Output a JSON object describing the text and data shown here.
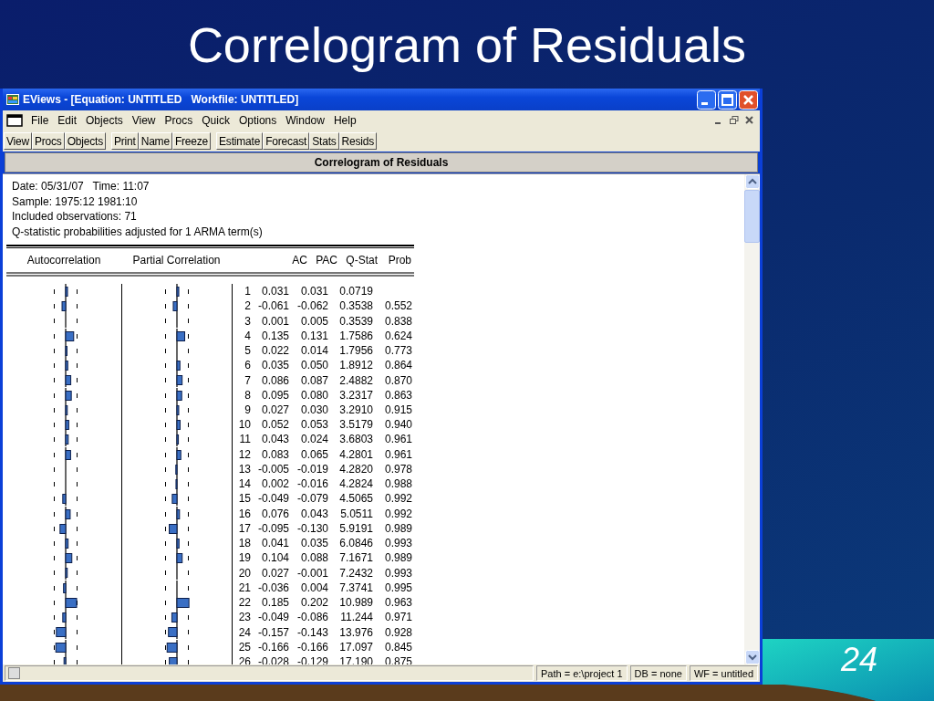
{
  "slide": {
    "title": "Correlogram of Residuals",
    "page_number": "24"
  },
  "window": {
    "title": "EViews - [Equation: UNTITLED   Workfile: UNTITLED]"
  },
  "menu": [
    "File",
    "Edit",
    "Objects",
    "View",
    "Procs",
    "Quick",
    "Options",
    "Window",
    "Help"
  ],
  "toolbar": [
    [
      "View",
      "Procs",
      "Objects"
    ],
    [
      "Print",
      "Name",
      "Freeze"
    ],
    [
      "Estimate",
      "Forecast",
      "Stats",
      "Resids"
    ]
  ],
  "view_title": "Correlogram of Residuals",
  "info_lines": [
    "Date: 05/31/07   Time: 11:07",
    "Sample: 1975:12 1981:10",
    "Included observations: 71",
    "Q-statistic probabilities adjusted for 1 ARMA term(s)"
  ],
  "table": {
    "columns": [
      "Autocorrelation",
      "Partial Correlation",
      "AC",
      "PAC",
      "Q-Stat",
      "Prob"
    ],
    "rows": [
      {
        "lag": "1",
        "ac": "0.031",
        "pac": "0.031",
        "q_stat": "0.0719"
      },
      {
        "lag": "2",
        "ac": "-0.061",
        "pac": "-0.062",
        "q_stat": "0.3538",
        "prob": "0.552"
      },
      {
        "lag": "3",
        "ac": "0.001",
        "pac": "0.005",
        "q_stat": "0.3539",
        "prob": "0.838"
      },
      {
        "lag": "4",
        "ac": "0.135",
        "pac": "0.131",
        "q_stat": "1.7586",
        "prob": "0.624"
      },
      {
        "lag": "5",
        "ac": "0.022",
        "pac": "0.014",
        "q_stat": "1.7956",
        "prob": "0.773"
      },
      {
        "lag": "6",
        "ac": "0.035",
        "pac": "0.050",
        "q_stat": "1.8912",
        "prob": "0.864"
      },
      {
        "lag": "7",
        "ac": "0.086",
        "pac": "0.087",
        "q_stat": "2.4882",
        "prob": "0.870"
      },
      {
        "lag": "8",
        "ac": "0.095",
        "pac": "0.080",
        "q_stat": "3.2317",
        "prob": "0.863"
      },
      {
        "lag": "9",
        "ac": "0.027",
        "pac": "0.030",
        "q_stat": "3.2910",
        "prob": "0.915"
      },
      {
        "lag": "10",
        "ac": "0.052",
        "pac": "0.053",
        "q_stat": "3.5179",
        "prob": "0.940"
      },
      {
        "lag": "11",
        "ac": "0.043",
        "pac": "0.024",
        "q_stat": "3.6803",
        "prob": "0.961"
      },
      {
        "lag": "12",
        "ac": "0.083",
        "pac": "0.065",
        "q_stat": "4.2801",
        "prob": "0.961"
      },
      {
        "lag": "13",
        "ac": "-0.005",
        "pac": "-0.019",
        "q_stat": "4.2820",
        "prob": "0.978"
      },
      {
        "lag": "14",
        "ac": "0.002",
        "pac": "-0.016",
        "q_stat": "4.2824",
        "prob": "0.988"
      },
      {
        "lag": "15",
        "ac": "-0.049",
        "pac": "-0.079",
        "q_stat": "4.5065",
        "prob": "0.992"
      },
      {
        "lag": "16",
        "ac": "0.076",
        "pac": "0.043",
        "q_stat": "5.0511",
        "prob": "0.992"
      },
      {
        "lag": "17",
        "ac": "-0.095",
        "pac": "-0.130",
        "q_stat": "5.9191",
        "prob": "0.989"
      },
      {
        "lag": "18",
        "ac": "0.041",
        "pac": "0.035",
        "q_stat": "6.0846",
        "prob": "0.993"
      },
      {
        "lag": "19",
        "ac": "0.104",
        "pac": "0.088",
        "q_stat": "7.1671",
        "prob": "0.989"
      },
      {
        "lag": "20",
        "ac": "0.027",
        "pac": "-0.001",
        "q_stat": "7.2432",
        "prob": "0.993"
      },
      {
        "lag": "21",
        "ac": "-0.036",
        "pac": "0.004",
        "q_stat": "7.3741",
        "prob": "0.995"
      },
      {
        "lag": "22",
        "ac": "0.185",
        "pac": "0.202",
        "q_stat": "10.989",
        "prob": "0.963"
      },
      {
        "lag": "23",
        "ac": "-0.049",
        "pac": "-0.086",
        "q_stat": "11.244",
        "prob": "0.971"
      },
      {
        "lag": "24",
        "ac": "-0.157",
        "pac": "-0.143",
        "q_stat": "13.976",
        "prob": "0.928"
      },
      {
        "lag": "25",
        "ac": "-0.166",
        "pac": "-0.166",
        "q_stat": "17.097",
        "prob": "0.845"
      },
      {
        "lag": "26",
        "ac": "-0.028",
        "pac": "-0.129",
        "q_stat": "17.190",
        "prob": "0.875"
      }
    ]
  },
  "status_bar": [
    "Path = e:\\project 1",
    "DB = none",
    "WF = untitled"
  ]
}
